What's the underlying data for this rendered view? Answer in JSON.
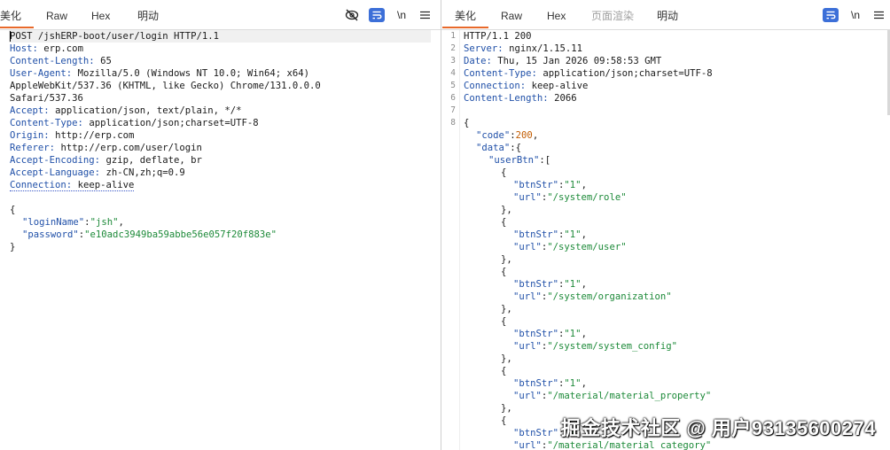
{
  "left": {
    "tabs": [
      {
        "label": "美化"
      },
      {
        "label": "Raw"
      },
      {
        "label": "Hex"
      },
      {
        "label": "明动"
      }
    ],
    "tools": {
      "hide_icon": "eye-slash-icon",
      "wrap_icon": "wrap-lines-icon",
      "newline_label": "\\n",
      "menu_icon": "menu-icon"
    },
    "request_line": "POST /jshERP-boot/user/login HTTP/1.1",
    "headers": [
      {
        "name": "Host",
        "value": "erp.com"
      },
      {
        "name": "Content-Length",
        "value": "65"
      },
      {
        "name": "User-Agent",
        "value": "Mozilla/5.0 (Windows NT 10.0; Win64; x64)"
      },
      {
        "name": "",
        "value": "AppleWebKit/537.36 (KHTML, like Gecko) Chrome/131.0.0.0"
      },
      {
        "name": "",
        "value": "Safari/537.36"
      },
      {
        "name": "Accept",
        "value": "application/json, text/plain, */*"
      },
      {
        "name": "Content-Type",
        "value": "application/json;charset=UTF-8"
      },
      {
        "name": "Origin",
        "value": "http://erp.com"
      },
      {
        "name": "Referer",
        "value": "http://erp.com/user/login"
      },
      {
        "name": "Accept-Encoding",
        "value": "gzip, deflate, br"
      },
      {
        "name": "Accept-Language",
        "value": "zh-CN,zh;q=0.9"
      },
      {
        "name": "Connection",
        "value": "keep-alive"
      }
    ],
    "body": {
      "open": "{",
      "fields": [
        {
          "key": "\"loginName\"",
          "value": "\"jsh\"",
          "comma": ","
        },
        {
          "key": "\"password\"",
          "value": "\"e10adc3949ba59abbe56e057f20f883e\"",
          "comma": ""
        }
      ],
      "close": "}"
    }
  },
  "right": {
    "tabs": [
      {
        "label": "美化"
      },
      {
        "label": "Raw"
      },
      {
        "label": "Hex"
      },
      {
        "label": "页面渲染"
      },
      {
        "label": "明动"
      }
    ],
    "tools": {
      "wrap_icon": "wrap-lines-icon",
      "newline_label": "\\n",
      "menu_icon": "menu-icon"
    },
    "line_numbers": [
      "1",
      "2",
      "3",
      "4",
      "5",
      "6",
      "7",
      "8"
    ],
    "status_line": "HTTP/1.1 200",
    "headers": [
      {
        "name": "Server",
        "value": "nginx/1.15.11"
      },
      {
        "name": "Date",
        "value": "Thu, 15 Jan 2026 09:58:53 GMT"
      },
      {
        "name": "Content-Type",
        "value": "application/json;charset=UTF-8"
      },
      {
        "name": "Connection",
        "value": "keep-alive"
      },
      {
        "name": "Content-Length",
        "value": "2066"
      }
    ],
    "json": {
      "open": "{",
      "code_key": "\"code\"",
      "code_value": "200",
      "data_key": "\"data\"",
      "userbtn_key": "\"userBtn\"",
      "btnstr_key": "\"btnStr\"",
      "url_key": "\"url\"",
      "items": [
        {
          "btnStr": "\"1\"",
          "url": "\"/system/role\""
        },
        {
          "btnStr": "\"1\"",
          "url": "\"/system/user\""
        },
        {
          "btnStr": "\"1\"",
          "url": "\"/system/organization\""
        },
        {
          "btnStr": "\"1\"",
          "url": "\"/system/system_config\""
        },
        {
          "btnStr": "\"1\"",
          "url": "\"/material/material_property\""
        },
        {
          "btnStr": "\"1\"",
          "url": "\"/material/material_category\""
        }
      ]
    }
  },
  "watermark": "掘金技术社区 @ 用户93135600274"
}
